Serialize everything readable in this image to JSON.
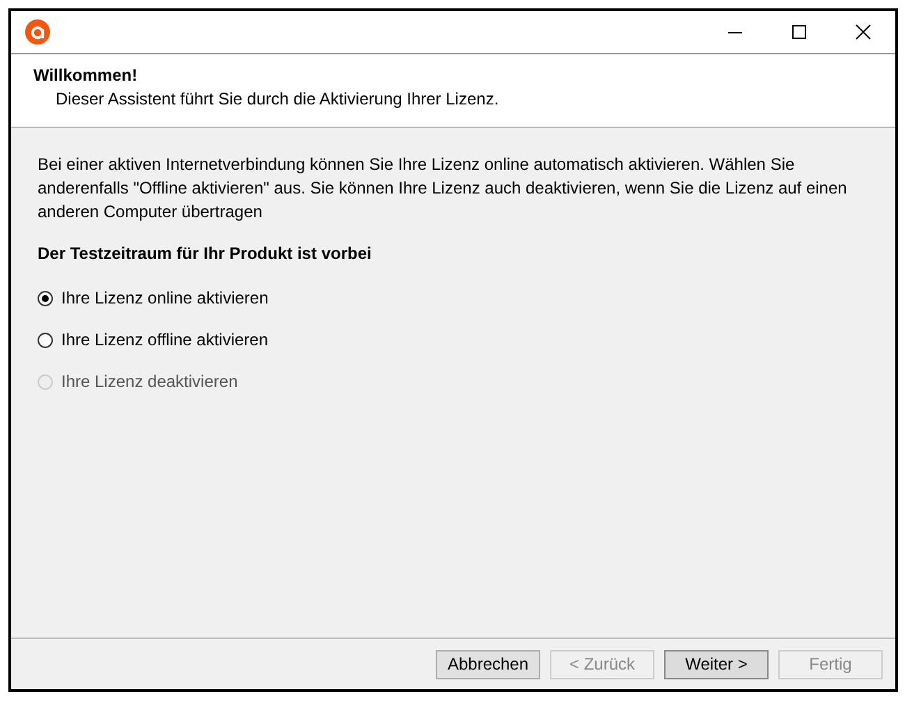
{
  "window": {
    "controls": [
      {
        "kind": "minimize"
      },
      {
        "kind": "maximize"
      },
      {
        "kind": "close"
      }
    ]
  },
  "header": {
    "title": "Willkommen!",
    "subtitle": "Dieser Assistent führt Sie durch die Aktivierung Ihrer Lizenz."
  },
  "intro": "Bei einer aktiven Internetverbindung können Sie Ihre Lizenz online automatisch aktivieren. Wählen Sie anderenfalls \"Offline aktivieren\" aus. Sie können Ihre Lizenz auch deaktivieren, wenn Sie die Lizenz auf einen anderen Computer übertragen",
  "notice": "Der Testzeitraum für Ihr Produkt ist vorbei",
  "options": [
    {
      "label": "Ihre Lizenz online aktivieren",
      "selected": true,
      "disabled": false
    },
    {
      "label": "Ihre Lizenz offline aktivieren",
      "selected": false,
      "disabled": false
    },
    {
      "label": "Ihre Lizenz deaktivieren",
      "selected": false,
      "disabled": true
    }
  ],
  "buttons": [
    {
      "label": "Abbrechen",
      "disabled": false,
      "default": false
    },
    {
      "label": "< Zurück",
      "disabled": true,
      "default": false
    },
    {
      "label": "Weiter >",
      "disabled": false,
      "default": true
    },
    {
      "label": "Fertig",
      "disabled": true,
      "default": false
    }
  ]
}
